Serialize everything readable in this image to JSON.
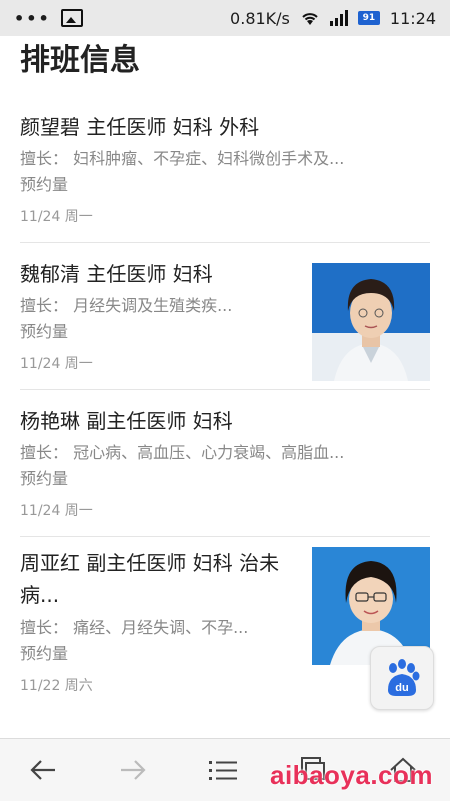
{
  "status_bar": {
    "dots": "•••",
    "speed": "0.81K/s",
    "battery": "91",
    "time": "11:24",
    "icons": [
      "image-icon",
      "wifi-icon",
      "signal-icon",
      "battery-icon"
    ]
  },
  "page": {
    "title": "排班信息"
  },
  "doctors": [
    {
      "name_line": "颜望碧 主任医师 妇科 外科",
      "speciality": "擅长：  妇科肿瘤、不孕症、妇科微创手术及...",
      "booking": "预约量",
      "date": "11/24 周一",
      "has_photo": false
    },
    {
      "name_line": "魏郁清 主任医师 妇科",
      "speciality": "擅长：  月经失调及生殖类疾...",
      "booking": "预约量",
      "date": "11/24 周一",
      "has_photo": true
    },
    {
      "name_line": "杨艳琳 副主任医师 妇科",
      "speciality": "擅长：  冠心病、高血压、心力衰竭、高脂血...",
      "booking": "预约量",
      "date": "11/24 周一",
      "has_photo": false
    },
    {
      "name_line": "周亚红 副主任医师 妇科 治未病...",
      "speciality": "擅长：  痛经、月经失调、不孕...",
      "booking": "预约量",
      "date": "11/22 周六",
      "has_photo": true
    }
  ],
  "floating": {
    "baidu_label": "du"
  },
  "bottom_nav": {
    "items": [
      "back-arrow-icon",
      "forward-arrow-icon",
      "menu-list-icon",
      "windows-icon",
      "home-icon"
    ]
  },
  "watermark": {
    "text": "aibaoya.com"
  },
  "colors": {
    "status_bar_bg": "#e9e9e9",
    "divider": "#e5e5e5",
    "secondary_text": "#888888",
    "watermark": "#e8315a",
    "baidu_blue": "#2b6de0"
  }
}
